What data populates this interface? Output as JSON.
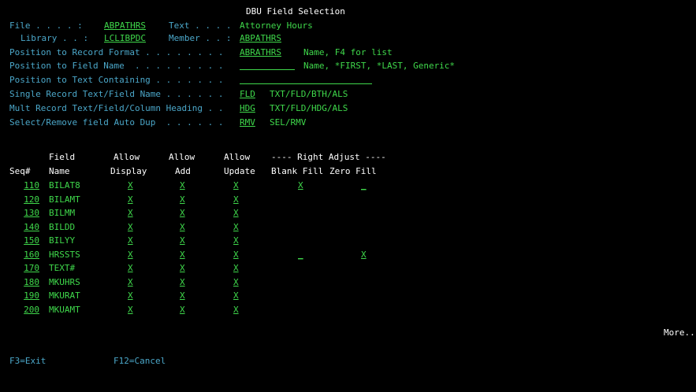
{
  "screen": {
    "title": "DBU Field Selection",
    "file_label": "File . . . . :",
    "file_value": "ABPATHRS",
    "text_label": "Text . . . .",
    "text_value": "Attorney Hours",
    "library_label": "Library . . :",
    "library_value": "LCLIBPDC",
    "member_label": "Member . . :",
    "member_value": "ABPATHRS",
    "pos_record_label": "Position to Record Format . . . . . . . .",
    "pos_record_value": "ABRATHRS",
    "pos_record_hint": "Name, F4 for list",
    "pos_field_label": "Position to Field Name  . . . . . . . . .",
    "pos_field_value": "",
    "pos_field_hint": "Name, *FIRST, *LAST, Generic*",
    "pos_text_label": "Position to Text Containing . . . . . . .",
    "pos_text_value": "",
    "single_label": "Single Record Text/Field Name . . . . . .",
    "single_value": "FLD",
    "single_hint": "TXT/FLD/BTH/ALS",
    "mult_label": "Mult Record Text/Field/Column Heading . .",
    "mult_value": "HDG",
    "mult_hint": "TXT/FLD/HDG/ALS",
    "dup_label": "Select/Remove field Auto Dup  . . . . . .",
    "dup_value": "RMV",
    "dup_hint": "SEL/RMV"
  },
  "headers": {
    "field_top": "Field",
    "allow1_top": "Allow",
    "allow2_top": "Allow",
    "allow3_top": "Allow",
    "right_adjust": "---- Right Adjust ----",
    "seq": "Seq#",
    "name": "Name",
    "display": "Display",
    "add": "Add",
    "update": "Update",
    "blank_fill": "Blank Fill",
    "zero_fill": "Zero Fill"
  },
  "rows": [
    {
      "seq": "110",
      "name": "BILAT8",
      "display": "X",
      "add": "X",
      "update": "X",
      "blank": "X",
      "zero": "_"
    },
    {
      "seq": "120",
      "name": "BILAMT",
      "display": "X",
      "add": "X",
      "update": "X",
      "blank": "",
      "zero": ""
    },
    {
      "seq": "130",
      "name": "BILMM",
      "display": "X",
      "add": "X",
      "update": "X",
      "blank": "",
      "zero": ""
    },
    {
      "seq": "140",
      "name": "BILDD",
      "display": "X",
      "add": "X",
      "update": "X",
      "blank": "",
      "zero": ""
    },
    {
      "seq": "150",
      "name": "BILYY",
      "display": "X",
      "add": "X",
      "update": "X",
      "blank": "",
      "zero": ""
    },
    {
      "seq": "160",
      "name": "HRSSTS",
      "display": "X",
      "add": "X",
      "update": "X",
      "blank": "_",
      "zero": "X"
    },
    {
      "seq": "170",
      "name": "TEXT#",
      "display": "X",
      "add": "X",
      "update": "X",
      "blank": "",
      "zero": ""
    },
    {
      "seq": "180",
      "name": "MKUHRS",
      "display": "X",
      "add": "X",
      "update": "X",
      "blank": "",
      "zero": ""
    },
    {
      "seq": "190",
      "name": "MKURAT",
      "display": "X",
      "add": "X",
      "update": "X",
      "blank": "",
      "zero": ""
    },
    {
      "seq": "200",
      "name": "MKUAMT",
      "display": "X",
      "add": "X",
      "update": "X",
      "blank": "",
      "zero": ""
    }
  ],
  "more": "More..",
  "fkeys": {
    "f3": "F3=Exit",
    "f12": "F12=Cancel"
  }
}
